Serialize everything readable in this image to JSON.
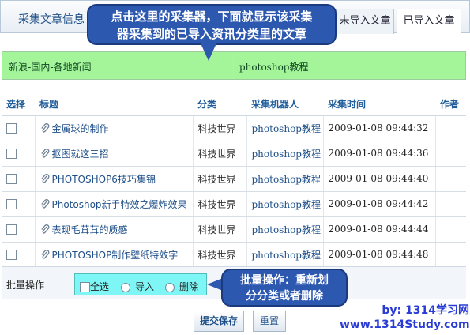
{
  "panel": {
    "title": "采集文章信息"
  },
  "tabs": [
    {
      "label": "未导入文章",
      "active": false
    },
    {
      "label": "已导入文章",
      "active": true
    }
  ],
  "callout_top": {
    "line1": "点击这里的采集器，下面就显示该采集",
    "line2": "器采集到的已导入资讯分类里的文章"
  },
  "categories": [
    {
      "label": "新浪-国内-各地新闻"
    },
    {
      "label": "photoshop教程"
    }
  ],
  "table": {
    "headers": [
      "选择",
      "标题",
      "分类",
      "采集机器人",
      "采集时间",
      "作者"
    ],
    "rows": [
      {
        "title": "金属球的制作",
        "category": "科技世界",
        "robot": "photoshop教程",
        "time": "2009-01-08 09:44:32",
        "author": ""
      },
      {
        "title": "抠图就这三招",
        "category": "科技世界",
        "robot": "photoshop教程",
        "time": "2009-01-08 09:44:36",
        "author": ""
      },
      {
        "title": "PHOTOSHOP6技巧集锦",
        "category": "科技世界",
        "robot": "photoshop教程",
        "time": "2009-01-08 09:44:40",
        "author": ""
      },
      {
        "title": "Photoshop新手特效之爆炸效果",
        "category": "科技世界",
        "robot": "photoshop教程",
        "time": "2009-01-08 09:44:42",
        "author": ""
      },
      {
        "title": "表现毛茸茸的质感",
        "category": "科技世界",
        "robot": "photoshop教程",
        "time": "2009-01-08 09:44:44",
        "author": ""
      },
      {
        "title": "PHOTOSHOP制作壁纸特效字",
        "category": "科技世界",
        "robot": "photoshop教程",
        "time": "2009-01-08 09:44:48",
        "author": ""
      }
    ]
  },
  "batch": {
    "label": "批量操作",
    "options": {
      "select_all": "全选",
      "import": "导入",
      "delete": "删除"
    }
  },
  "callout_bottom": {
    "line1": "批量操作：重新划",
    "line2": "分分类或者删除"
  },
  "buttons": {
    "submit": "提交保存",
    "reset": "重置"
  },
  "watermark": {
    "line1": "by: 1314学习网",
    "line2": "www.1314Study.com"
  },
  "colors": {
    "accent": "#2d58b0",
    "category_bar": "#a4f59a",
    "batch_highlight": "#7ef6f6",
    "link": "#1e4f88"
  }
}
